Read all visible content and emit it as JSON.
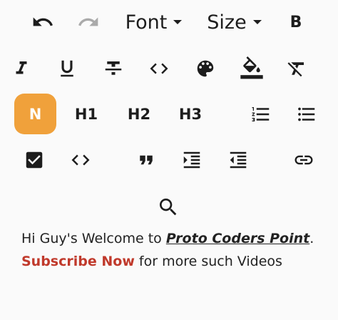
{
  "toolbar": {
    "font_label": "Font",
    "size_label": "Size",
    "bold_label": "B",
    "normal_label": "N",
    "h1_label": "H1",
    "h2_label": "H2",
    "h3_label": "H3",
    "icons": [
      "undo-icon",
      "redo-icon",
      "italic-icon",
      "underline-icon",
      "strikethrough-icon",
      "inline-code-icon",
      "text-color-icon",
      "background-color-icon",
      "clear-format-icon",
      "ordered-list-icon",
      "bullet-list-icon",
      "checklist-icon",
      "code-block-icon",
      "quote-icon",
      "indent-icon",
      "outdent-icon",
      "link-icon",
      "search-icon"
    ]
  },
  "editor": {
    "line1_prefix": "Hi Guy's Welcome to ",
    "line1_link": "Proto Coders Point",
    "line1_suffix": ".",
    "line2_highlight": "Subscribe Now",
    "line2_rest": " for more such Videos"
  },
  "colors": {
    "accent": "#f0a13b",
    "highlight_text": "#c0392b",
    "disabled_icon": "#aaaaaa",
    "icon": "#1d1d1d"
  }
}
